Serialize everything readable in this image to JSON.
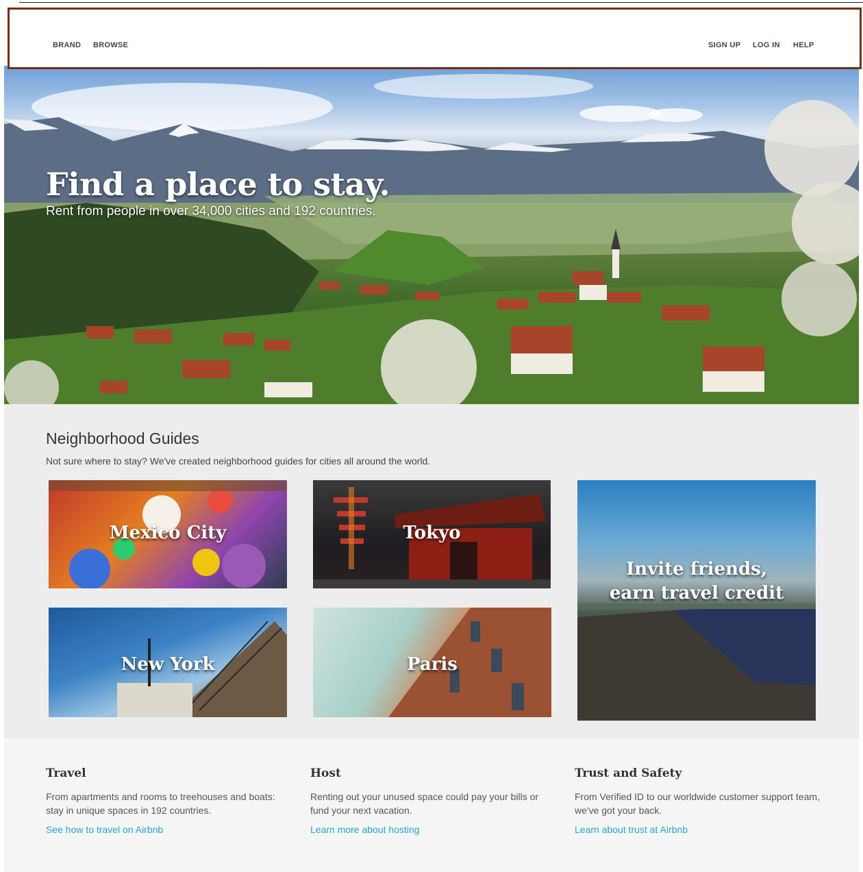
{
  "nav": {
    "brand": "BRAND",
    "browse": "BROWSE",
    "signup": "SIGN UP",
    "login": "LOG IN",
    "help": "HELP"
  },
  "hero": {
    "title": "Find a place to stay.",
    "subtitle": "Rent from people in over 34,000 cities and 192 countries."
  },
  "guides": {
    "title": "Neighborhood Guides",
    "subtitle": "Not sure where to stay? We've created neighborhood guides for cities all around the world.",
    "cities": [
      "Mexico City",
      "Tokyo",
      "New York",
      "Paris"
    ],
    "invite_line1": "Invite friends,",
    "invite_line2": "earn travel credit"
  },
  "footer": {
    "columns": [
      {
        "title": "Travel",
        "text": "From apartments and rooms to treehouses and boats: stay in unique spaces in 192 countries.",
        "link": "See how to travel on Airbnb"
      },
      {
        "title": "Host",
        "text": "Renting out your unused space could pay your bills or fund your next vacation.",
        "link": "Learn more about hosting"
      },
      {
        "title": "Trust and Safety",
        "text": "From Verified ID to our worldwide customer support team, we've got your back.",
        "link": "Learn about trust at Airbnb"
      }
    ]
  },
  "colors": {
    "nav_border": "#7a2e12",
    "link": "#21a8d8"
  }
}
